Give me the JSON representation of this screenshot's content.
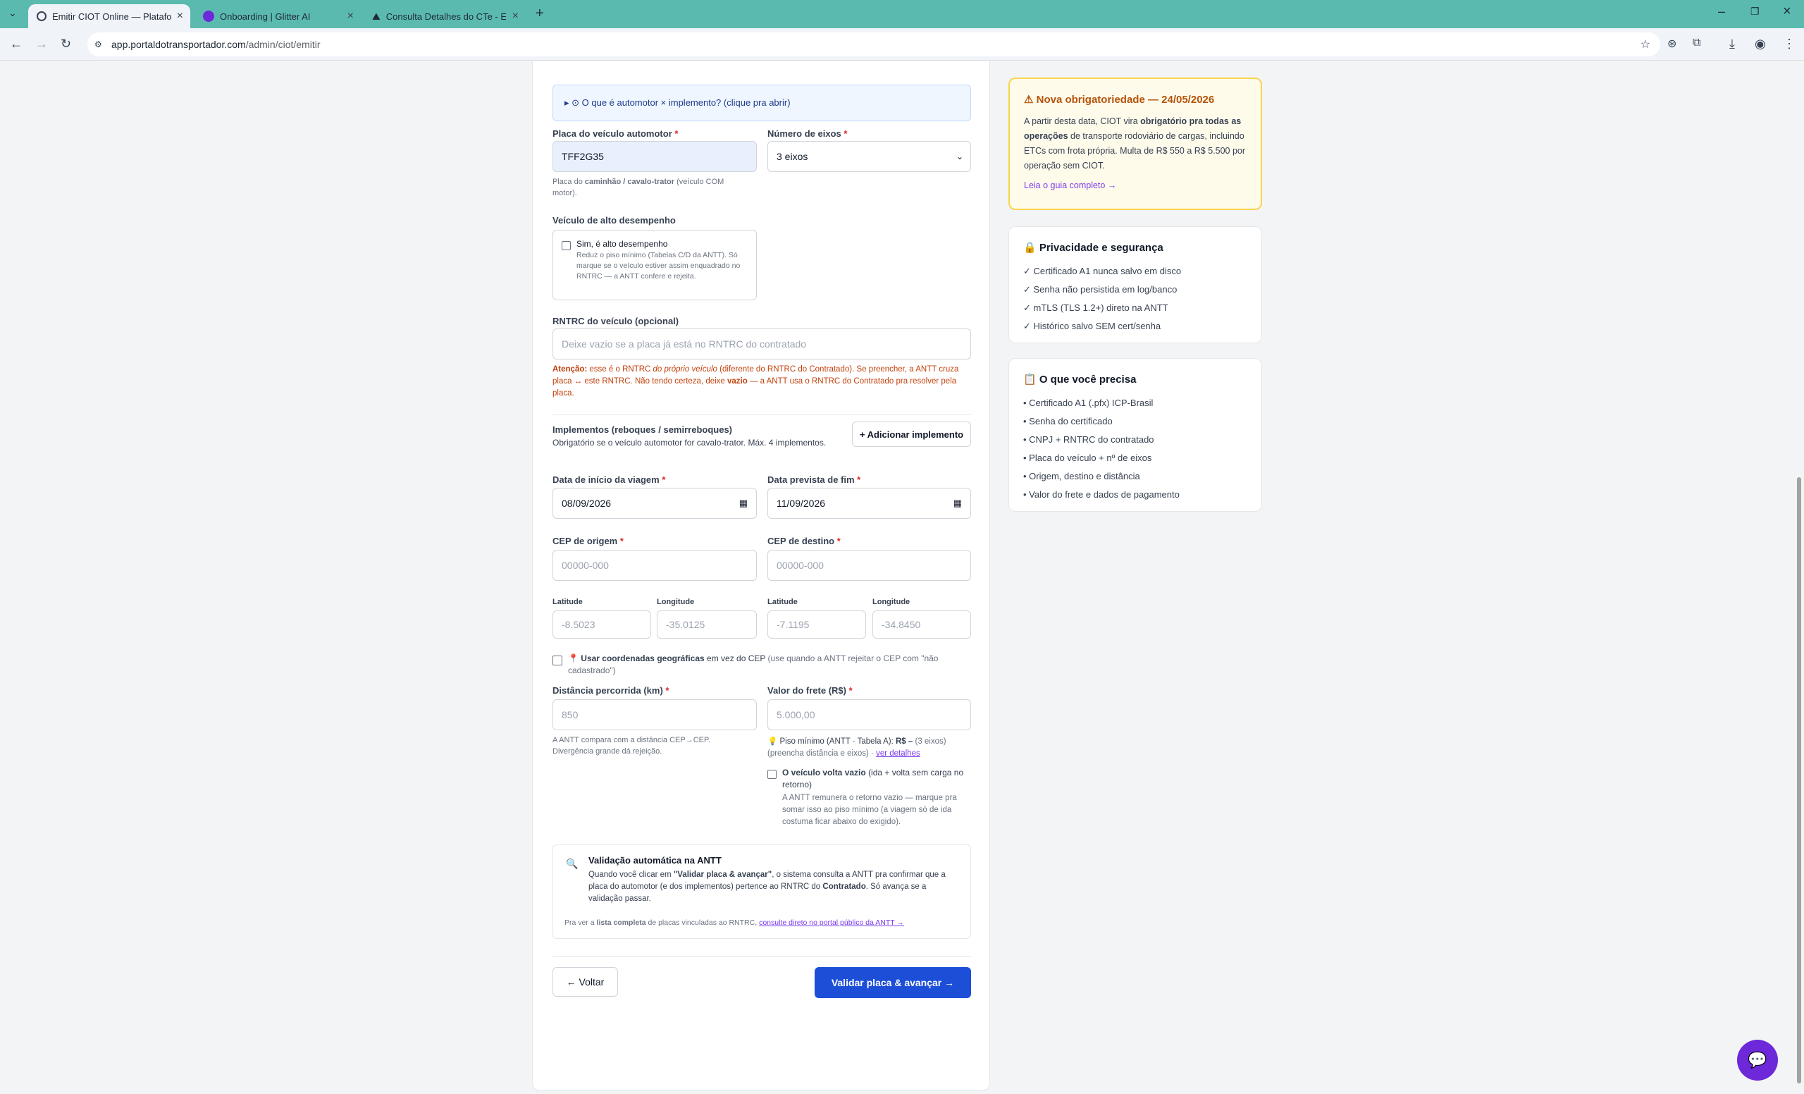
{
  "browser": {
    "tabs": [
      {
        "title": "Emitir CIOT Online — Plataform"
      },
      {
        "title": "Onboarding | Glitter AI"
      },
      {
        "title": "Consulta Detalhes do CTe - ERP"
      }
    ],
    "url_host": "app.portaldotransportador.com",
    "url_path": "/admin/ciot/emitir"
  },
  "form": {
    "explainer": "▸ ⊙ O que é automotor × implemento? (clique pra abrir)",
    "placa_label": "Placa do veículo automotor",
    "required_mark": "*",
    "placa_value": "TFF2G35",
    "placa_hint_1": "Placa do",
    "placa_hint_bold": "caminhão / cavalo-trator",
    "placa_hint_2": "(veículo COM motor).",
    "eixos_label": "Número de eixos",
    "eixos_value": "3 eixos",
    "alto_label": "Veículo de alto desempenho",
    "alto_check_label": "Sim, é alto desempenho",
    "alto_check_desc": "Reduz o piso mínimo (Tabelas C/D da ANTT). Só marque se o veículo estiver assim enquadrado no RNTRC — a ANTT confere e rejeita.",
    "rntrc_label": "RNTRC do veículo (opcional)",
    "rntrc_placeholder": "Deixe vazio se a placa já está no RNTRC do contratado",
    "rntrc_warn_bold": "Atenção:",
    "rntrc_warn_1": "esse é o RNTRC",
    "rntrc_warn_italic": "do próprio veículo",
    "rntrc_warn_2": "(diferente do RNTRC do Contratado). Se preencher, a ANTT cruza placa ↔ este RNTRC. Não tendo certeza, deixe",
    "rntrc_warn_vazio": "vazio",
    "rntrc_warn_3": "— a ANTT usa o RNTRC do Contratado pra resolver pela placa.",
    "impl_title": "Implementos (reboques / semirreboques)",
    "impl_desc": "Obrigatório se o veículo automotor for cavalo-trator. Máx. 4 implementos.",
    "impl_button": "+ Adicionar implemento",
    "inicio_label": "Data de início da viagem",
    "inicio_value": "08/09/2026",
    "fim_label": "Data prevista de fim",
    "fim_value": "11/09/2026",
    "cep_origem_label": "CEP de origem",
    "cep_origem_placeholder": "00000-000",
    "cep_destino_label": "CEP de destino",
    "cep_destino_placeholder": "00000-000",
    "lat_label": "Latitude",
    "lon_label": "Longitude",
    "lat_origem_ph": "-8.5023",
    "lon_origem_ph": "-35.0125",
    "lat_destino_ph": "-7.1195",
    "lon_destino_ph": "-34.8450",
    "coords_bold": "📍 Usar coordenadas geográficas",
    "coords_1": "em vez do CEP",
    "coords_2": "(use quando a ANTT rejeitar o CEP com \"não cadastrado\")",
    "dist_label": "Distância percorrida (km)",
    "dist_placeholder": "850",
    "dist_hint": "A ANTT compara com a distância CEP→CEP. Divergência grande dá rejeição.",
    "frete_label": "Valor do frete (R$)",
    "frete_placeholder": "5.000,00",
    "piso_1": "💡 Piso mínimo (ANTT · Tabela A):",
    "piso_value": "R$ –",
    "piso_2": "(3 eixos)",
    "piso_3": "(preencha distância e eixos) ·",
    "piso_link": "ver detalhes",
    "vazio_bold": "O veículo volta vazio",
    "vazio_1": "(ida + volta sem carga no retorno)",
    "vazio_desc": "A ANTT remunera o retorno vazio — marque pra somar isso ao piso mínimo (a viagem só de ida costuma ficar abaixo do exigido).",
    "valid_title": "Validação automática na ANTT",
    "valid_1": "Quando você clicar em",
    "valid_bold": "\"Validar placa & avançar\"",
    "valid_2": ", o sistema consulta a ANTT pra confirmar que a placa do automotor (e dos implementos) pertence ao RNTRC do",
    "valid_contratado": "Contratado",
    "valid_3": ". Só avança se a validação passar.",
    "valid_foot_1": "Pra ver a",
    "valid_foot_bold": "lista completa",
    "valid_foot_2": "de placas vinculadas ao RNTRC,",
    "valid_foot_link": "consulte direto no portal público da ANTT →",
    "back_button": "← Voltar",
    "next_button": "Validar placa & avançar →"
  },
  "sidebar": {
    "notice_title": "⚠ Nova obrigatoriedade — 24/05/2026",
    "notice_1": "A partir desta data, CIOT vira",
    "notice_bold": "obrigatório pra todas as operações",
    "notice_2": "de transporte rodoviário de cargas, incluindo ETCs com frota própria. Multa de R$ 550 a R$ 5.500 por operação sem CIOT.",
    "notice_link": "Leia o guia completo →",
    "privacy_title": "🔒 Privacidade e segurança",
    "privacy_items": [
      "✓ Certificado A1 nunca salvo em disco",
      "✓ Senha não persistida em log/banco",
      "✓ mTLS (TLS 1.2+) direto na ANTT",
      "✓ Histórico salvo SEM cert/senha"
    ],
    "needs_title": "📋 O que você precisa",
    "needs_items": [
      "• Certificado A1 (.pfx) ICP-Brasil",
      "• Senha do certificado",
      "• CNPJ + RNTRC do contratado",
      "• Placa do veículo + nº de eixos",
      "• Origem, destino e distância",
      "• Valor do frete e dados de pagamento"
    ]
  },
  "colors": {
    "accent": "#1d4ed8",
    "warning": "#c2410c",
    "chrome": "#5bbab0"
  }
}
